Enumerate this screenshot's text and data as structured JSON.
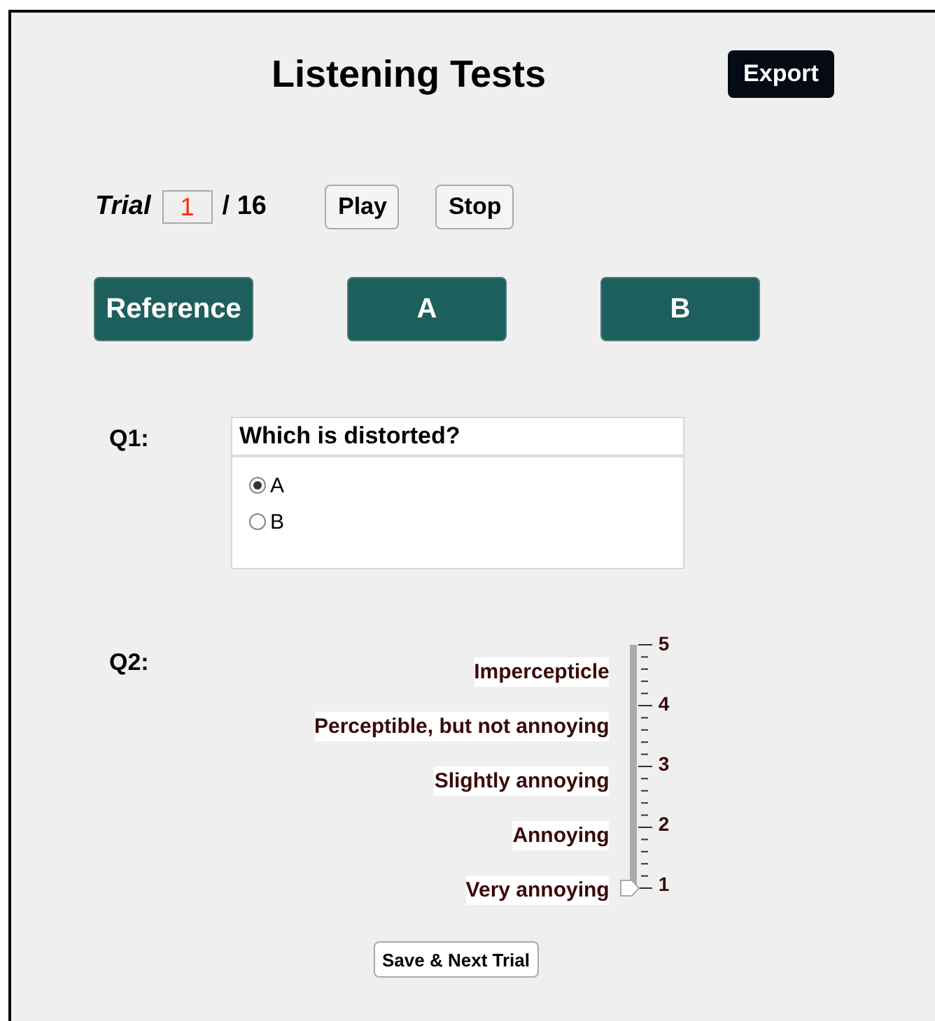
{
  "title": "Listening Tests",
  "export_button": "Export",
  "trial": {
    "label": "Trial",
    "value": "1",
    "total": "/ 16"
  },
  "transport_buttons": [
    "Play",
    "Stop"
  ],
  "sample_buttons": [
    "Reference",
    "A",
    "B"
  ],
  "q1": {
    "label": "Q1:",
    "question": "Which is distorted?",
    "options": [
      {
        "label": "A",
        "selected": true
      },
      {
        "label": "B",
        "selected": false
      }
    ]
  },
  "q2": {
    "label": "Q2:",
    "scale_labels": [
      "Impercepticle",
      "Perceptible, but not annoying",
      "Slightly annoying",
      "Annoying",
      "Very annoying"
    ],
    "ticks": [
      "5",
      "4",
      "3",
      "2",
      "1"
    ],
    "level": 0
  },
  "save_button": "Save & Next Trial"
}
